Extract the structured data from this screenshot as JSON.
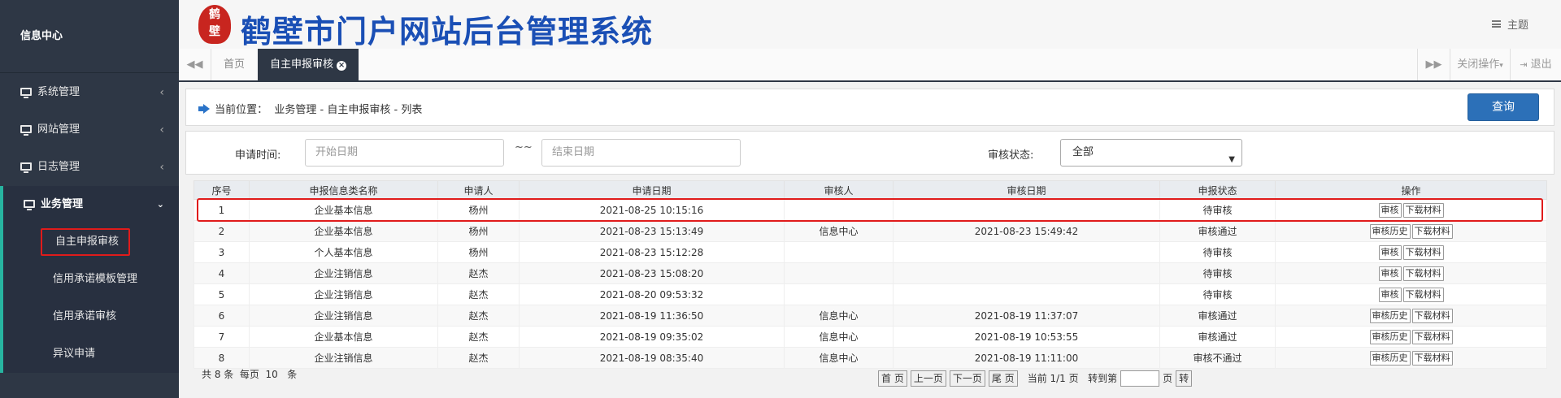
{
  "sidebar": {
    "user": "信息中心",
    "menu": [
      {
        "label": "系统管理"
      },
      {
        "label": "网站管理"
      },
      {
        "label": "日志管理"
      },
      {
        "label": "业务管理"
      }
    ],
    "submenu": [
      {
        "label": "自主申报审核"
      },
      {
        "label": "信用承诺模板管理"
      },
      {
        "label": "信用承诺审核"
      },
      {
        "label": "异议申请"
      }
    ]
  },
  "header": {
    "logo_text": "鹤壁",
    "title": "鹤壁市门户网站后台管理系统",
    "theme": "主题"
  },
  "tabs": {
    "home": "首页",
    "active": "自主申报审核",
    "close_ops": "关闭操作",
    "logout": "退出"
  },
  "breadcrumb": {
    "text": "当前位置：  业务管理 - 自主申报审核 - 列表"
  },
  "query_button": "查询",
  "filters": {
    "date_label": "申请时间:",
    "start_placeholder": "开始日期",
    "separator": "~~",
    "end_placeholder": "结束日期",
    "status_label": "审核状态:",
    "status_value": "全部"
  },
  "table": {
    "headers": [
      "序号",
      "申报信息类名称",
      "申请人",
      "申请日期",
      "审核人",
      "审核日期",
      "申报状态",
      "操作"
    ],
    "rows": [
      {
        "no": "1",
        "name": "企业基本信息",
        "applicant": "杨州",
        "apply_date": "2021-08-25 10:15:16",
        "reviewer": "",
        "review_date": "",
        "status": "待审核",
        "op1": "审核",
        "op2": "下载材料"
      },
      {
        "no": "2",
        "name": "企业基本信息",
        "applicant": "杨州",
        "apply_date": "2021-08-23 15:13:49",
        "reviewer": "信息中心",
        "review_date": "2021-08-23 15:49:42",
        "status": "审核通过",
        "op1": "审核历史",
        "op2": "下载材料"
      },
      {
        "no": "3",
        "name": "个人基本信息",
        "applicant": "杨州",
        "apply_date": "2021-08-23 15:12:28",
        "reviewer": "",
        "review_date": "",
        "status": "待审核",
        "op1": "审核",
        "op2": "下载材料"
      },
      {
        "no": "4",
        "name": "企业注销信息",
        "applicant": "赵杰",
        "apply_date": "2021-08-23 15:08:20",
        "reviewer": "",
        "review_date": "",
        "status": "待审核",
        "op1": "审核",
        "op2": "下载材料"
      },
      {
        "no": "5",
        "name": "企业注销信息",
        "applicant": "赵杰",
        "apply_date": "2021-08-20 09:53:32",
        "reviewer": "",
        "review_date": "",
        "status": "待审核",
        "op1": "审核",
        "op2": "下载材料"
      },
      {
        "no": "6",
        "name": "企业注销信息",
        "applicant": "赵杰",
        "apply_date": "2021-08-19 11:36:50",
        "reviewer": "信息中心",
        "review_date": "2021-08-19 11:37:07",
        "status": "审核通过",
        "op1": "审核历史",
        "op2": "下载材料"
      },
      {
        "no": "7",
        "name": "企业基本信息",
        "applicant": "赵杰",
        "apply_date": "2021-08-19 09:35:02",
        "reviewer": "信息中心",
        "review_date": "2021-08-19 10:53:55",
        "status": "审核通过",
        "op1": "审核历史",
        "op2": "下载材料"
      },
      {
        "no": "8",
        "name": "企业注销信息",
        "applicant": "赵杰",
        "apply_date": "2021-08-19 08:35:40",
        "reviewer": "信息中心",
        "review_date": "2021-08-19 11:11:00",
        "status": "审核不通过",
        "op1": "审核历史",
        "op2": "下载材料"
      }
    ]
  },
  "footer": {
    "summary": "共 8 条  每页  10   条"
  },
  "pager": {
    "first": "首 页",
    "prev": "上一页",
    "next": "下一页",
    "last": "尾 页",
    "info": "当前 1/1 页   转到第",
    "page_unit": "页",
    "go": "转"
  }
}
